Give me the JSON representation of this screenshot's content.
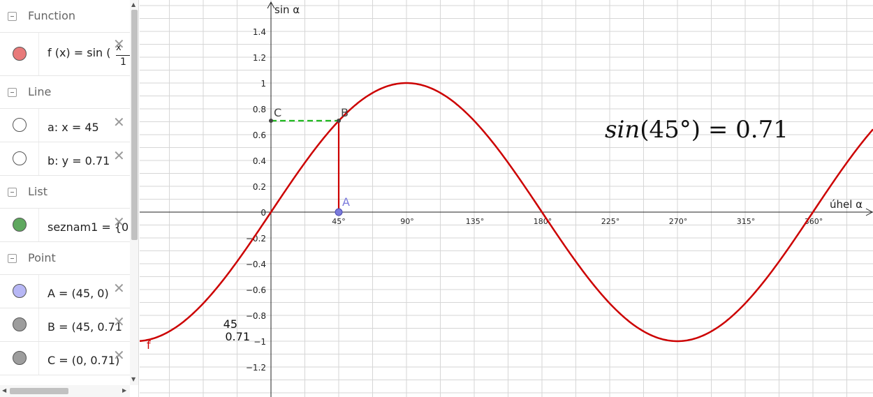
{
  "algebra": {
    "groups": [
      {
        "label": "Function"
      },
      {
        "label": "Line"
      },
      {
        "label": "List"
      },
      {
        "label": "Point"
      }
    ],
    "items": {
      "f": {
        "text": "f (x)  =  sin (",
        "frac_top": "x",
        "frac_bottom": "1",
        "color": "#e87a7a"
      },
      "a": {
        "text": "a: x  =  45",
        "color": "#ffffff"
      },
      "b": {
        "text": "b: y  =  0.71",
        "color": "#ffffff"
      },
      "seznam1": {
        "text": "seznam1  =  {0",
        "color": "#5fa85f"
      },
      "A": {
        "text": "A  =  (45, 0)",
        "color": "#b7b7f5"
      },
      "B": {
        "text": "B  =  (45, 0.71",
        "color": "#9d9d9d"
      },
      "C": {
        "text": "C  =  (0, 0.71)",
        "color": "#9d9d9d"
      }
    },
    "delete_glyph": "✕"
  },
  "graphics": {
    "y_axis_label": "sin α",
    "x_axis_label": "úhel α",
    "y_ticks": [
      "1.4",
      "1.2",
      "1",
      "0.8",
      "0.6",
      "0.4",
      "0.2",
      "0",
      "−0.2",
      "−0.4",
      "−0.6",
      "−0.8",
      "−1",
      "−1.2"
    ],
    "x_ticks": [
      "45°",
      "90°",
      "135°",
      "180°",
      "225°",
      "270°",
      "315°",
      "360°"
    ],
    "points": {
      "A": {
        "label": "A",
        "color": "#7b7bdc"
      },
      "B": {
        "label": "B",
        "color": "#444444"
      },
      "C": {
        "label": "C",
        "color": "#444444"
      }
    },
    "function_label": "f",
    "formula_fn": "sin",
    "formula_rest": "(45°) = 0.71",
    "side_value_1": "45",
    "side_value_2": "0.71",
    "colors": {
      "curve": "#cc0000",
      "dashed": "#22bb22",
      "grid": "#d6d6d6",
      "point_A": "#7b7bdc"
    }
  }
}
